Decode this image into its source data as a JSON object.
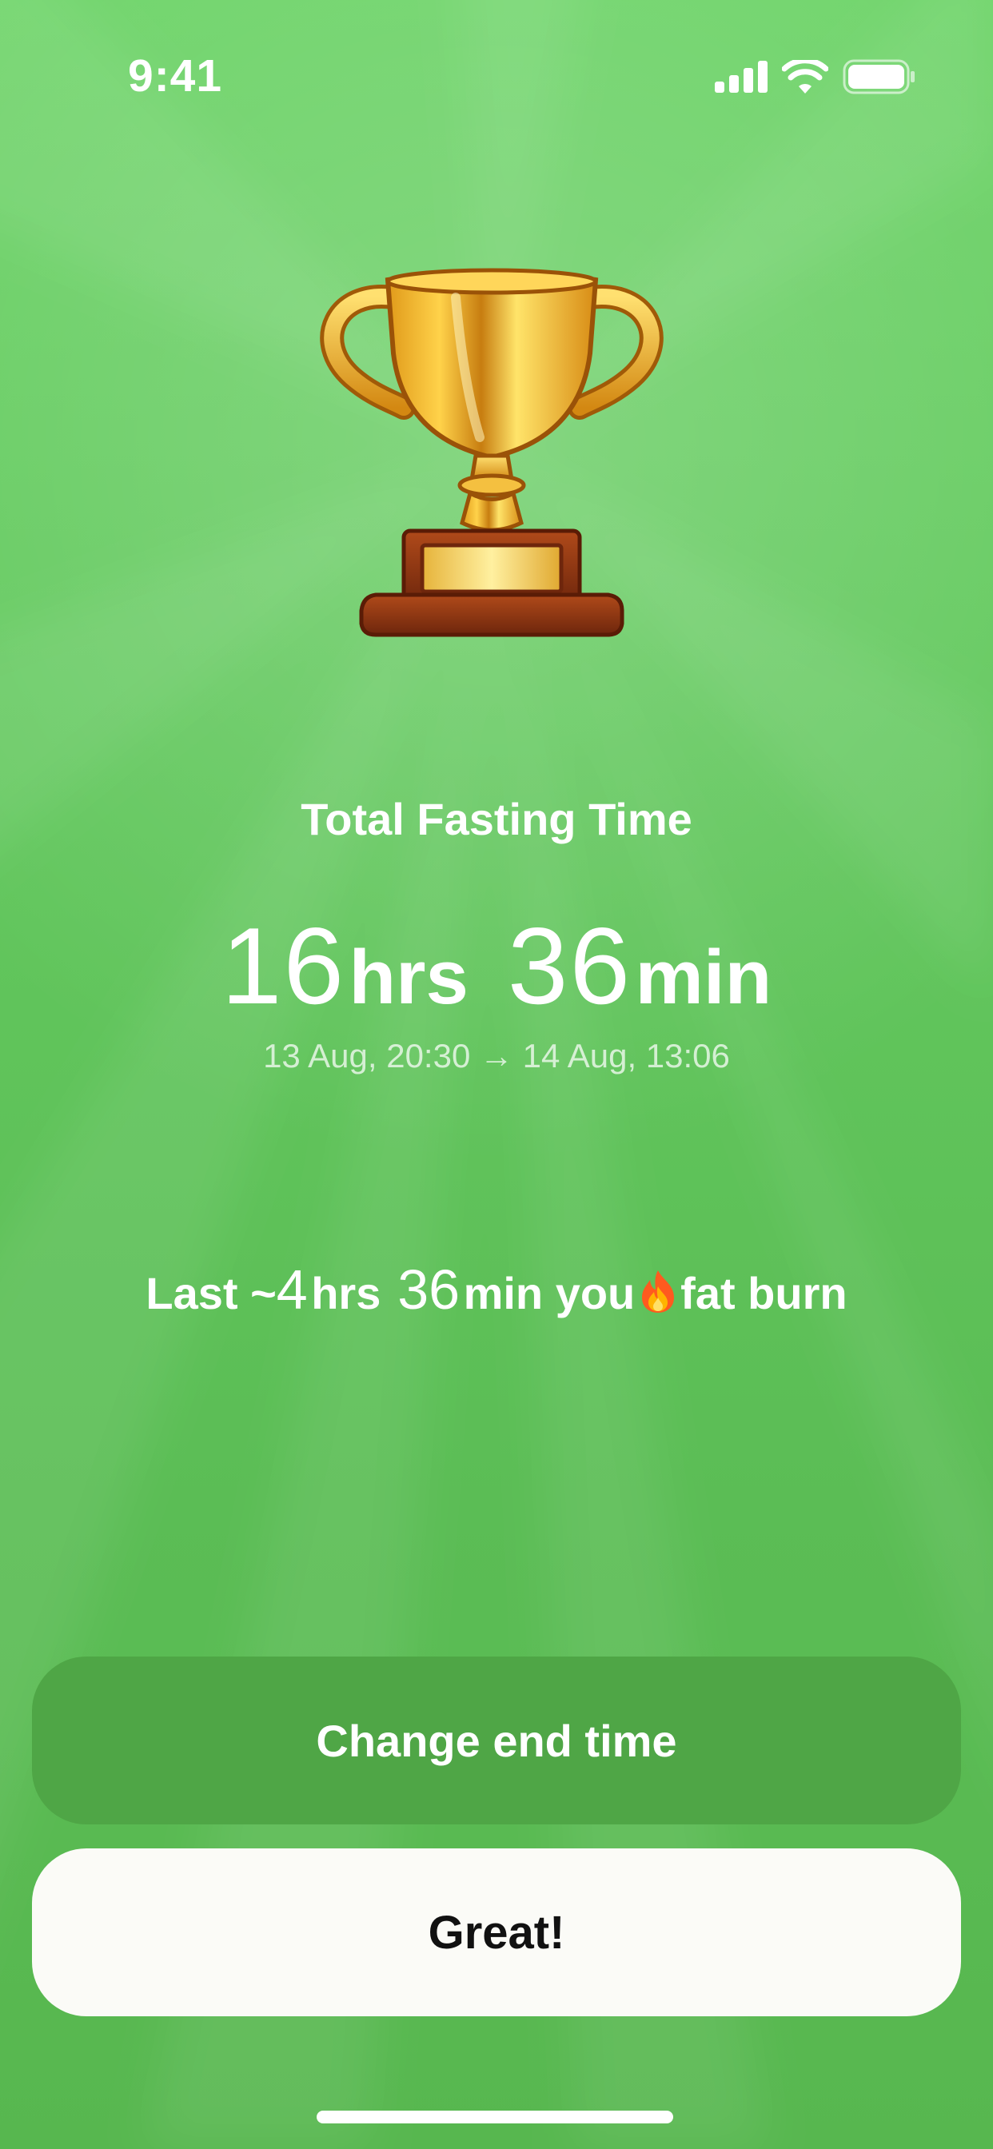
{
  "status_bar": {
    "time": "9:41",
    "icons": [
      "cellular-signal-icon",
      "wifi-icon",
      "battery-icon"
    ]
  },
  "trophy_icon": "trophy-icon",
  "summary": {
    "title": "Total Fasting Time",
    "hours_value": "16",
    "hours_unit": "hrs",
    "minutes_value": "36",
    "minutes_unit": "min",
    "range": "13 Aug, 20:30 → 14 Aug, 13:06"
  },
  "fat_burn": {
    "prefix": "Last ~",
    "hours_value": "4",
    "hours_unit": "hrs",
    "minutes_value": "36",
    "minutes_unit": "min you",
    "icon": "fire-icon",
    "suffix": "fat burn"
  },
  "buttons": {
    "change_end_time": "Change end time",
    "great": "Great!"
  },
  "colors": {
    "background": "#63c85e",
    "secondary_button": "#4fa646",
    "primary_button": "#fbfbf7",
    "text": "#ffffff"
  }
}
